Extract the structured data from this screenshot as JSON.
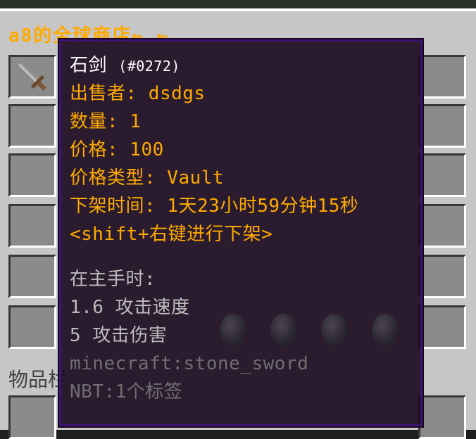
{
  "shop": {
    "title": "a8的全球商店← ←"
  },
  "inventory": {
    "label": "物品栏"
  },
  "tooltip": {
    "item_name": "石剑",
    "item_id": "(#0272)",
    "lines": [
      "出售者: dsdgs",
      "数量: 1",
      "价格: 100",
      "价格类型: Vault",
      "下架时间: 1天23小时59分钟15秒",
      "<shift+右键进行下架>"
    ],
    "attr_header": "在主手时:",
    "attributes": [
      " 1.6 攻击速度",
      " 5 攻击伤害"
    ],
    "registry_name": "minecraft:stone_sword",
    "nbt": "NBT:1个标签"
  },
  "colors": {
    "gold": "#ffaa00",
    "panel": "#c6c6c6",
    "slot": "#8b8b8b",
    "tooltip_border": "#3a1470"
  },
  "icons": [
    "stone-sword-icon",
    "spawn-egg-icon"
  ]
}
